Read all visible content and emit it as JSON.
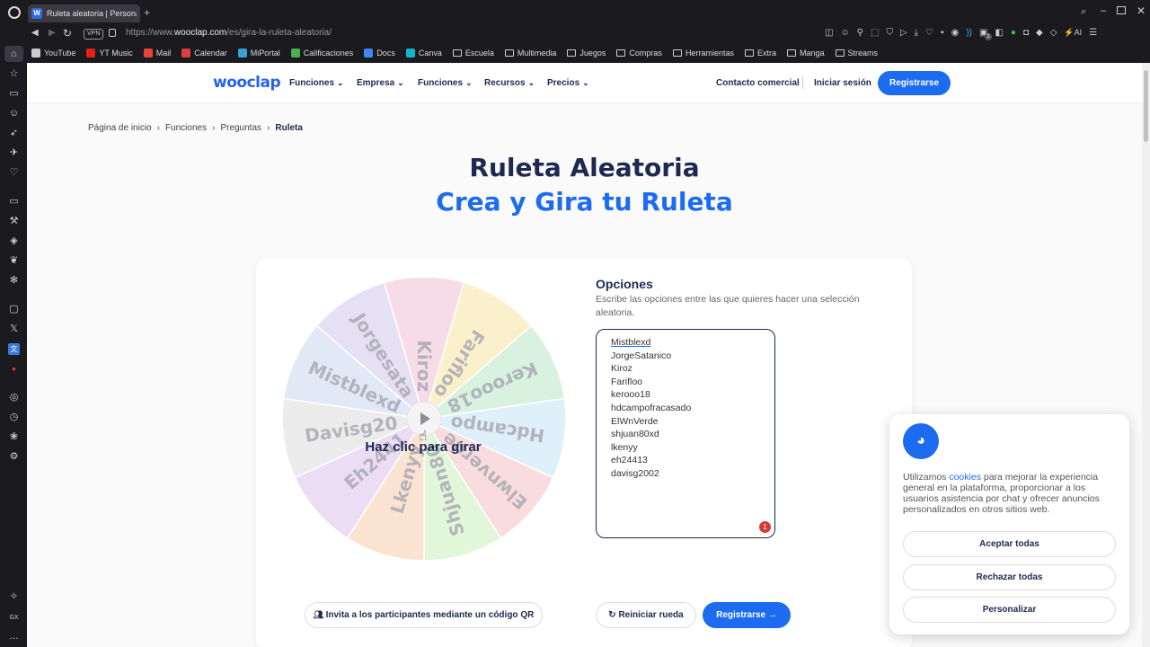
{
  "browser": {
    "tab_title": "Ruleta aleatoria | Personal",
    "url_prefix": "https://www.",
    "url_domain": "wooclap.com",
    "url_path": "/es/gira-la-ruleta-aleatoria/",
    "vpn": "VPN",
    "bookmarks": [
      {
        "label": "YouTube",
        "icon": "page-icon",
        "color": "#cccccc"
      },
      {
        "label": "YT Music",
        "icon": "ytmusic-icon",
        "color": "#e62117"
      },
      {
        "label": "Mail",
        "icon": "gmail-icon",
        "color": "#ea4335"
      },
      {
        "label": "Calendar",
        "icon": "calendar-icon",
        "color": "#e33b3b"
      },
      {
        "label": "MiPortal",
        "icon": "portal-icon",
        "color": "#3aa0d8"
      },
      {
        "label": "Calificaciones",
        "icon": "grades-icon",
        "color": "#4caf50"
      },
      {
        "label": "Docs",
        "icon": "docs-icon",
        "color": "#4285f4"
      },
      {
        "label": "Canva",
        "icon": "canva-icon",
        "color": "#12b5cb"
      },
      {
        "label": "Escuela",
        "icon": "folder-icon"
      },
      {
        "label": "Multimedia",
        "icon": "folder-icon"
      },
      {
        "label": "Juegos",
        "icon": "folder-icon"
      },
      {
        "label": "Compras",
        "icon": "folder-icon"
      },
      {
        "label": "Herramientas",
        "icon": "folder-icon"
      },
      {
        "label": "Extra",
        "icon": "folder-icon"
      },
      {
        "label": "Manga",
        "icon": "folder-icon"
      },
      {
        "label": "Streams",
        "icon": "folder-icon"
      }
    ],
    "sidebar_bottom_label": "GX",
    "extension_badge": "1"
  },
  "nav": {
    "logo": "wooclap",
    "menu": [
      "Funciones",
      "Empresa",
      "Funciones",
      "Recursos",
      "Precios"
    ],
    "contact": "Contacto comercial",
    "login": "Iniciar sesión",
    "register": "Registrarse"
  },
  "breadcrumb": {
    "items": [
      "Página de inicio",
      "Funciones",
      "Preguntas"
    ],
    "current": "Ruleta"
  },
  "hero": {
    "title": "Ruleta Aleatoria",
    "subtitle": "Crea y Gira tu Ruleta"
  },
  "wheel": {
    "hint": "Haz clic para girar",
    "segments": [
      "Kiroz",
      "Farifloo",
      "Kerooo18",
      "Hdcampo",
      "Elwnverde",
      "Shjuan80",
      "Lkenyy",
      "Eh2441",
      "Davisg20",
      "Mistblexd",
      "Jorgesata"
    ],
    "colors": [
      "#f6dce6",
      "#fbf0cc",
      "#d8f2df",
      "#dff0fb",
      "#f9dcde",
      "#e2f6d9",
      "#fbe3d2",
      "#ecdcf4",
      "#ececec",
      "#e1e8f6",
      "#e6e0f4"
    ]
  },
  "options": {
    "title": "Opciones",
    "description": "Escribe las opciones entre las que quieres hacer una selección aleatoria.",
    "items": [
      "Mistblexd",
      "JorgeSatanico",
      "Kiroz",
      "Farifloo",
      "kerooo18",
      "hdcampofracasado",
      "ElWnVerde",
      "shjuan80xd",
      "lkenyy",
      "eh24413",
      "davisg2002"
    ],
    "badge": "1"
  },
  "actions": {
    "qr": "Invita a los participantes mediante un código QR",
    "reset": "Reiniciar rueda",
    "register": "Registrarse"
  },
  "cookie": {
    "text_before": "Utilizamos ",
    "link": "cookies",
    "text_after": " para mejorar la experiencia general en la plataforma, proporcionar a los usuarios asistencia por chat y ofrecer anuncios personalizados en otros sitios web.",
    "accept": "Aceptar todas",
    "reject": "Rechazar todas",
    "customize": "Personalizar"
  }
}
